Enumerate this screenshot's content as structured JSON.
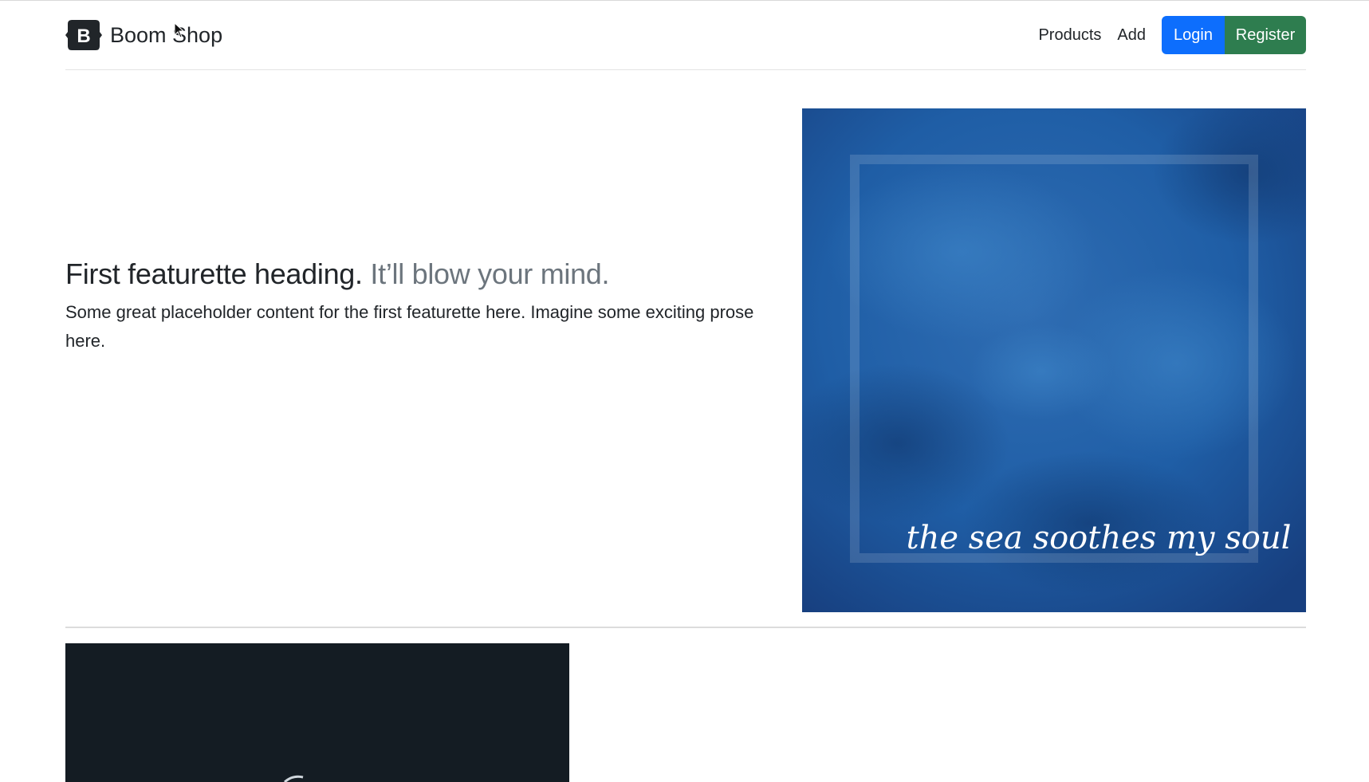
{
  "header": {
    "brand_letter": "B",
    "brand_name": "Boom Shop",
    "nav": {
      "products_label": "Products",
      "add_label": "Add",
      "login_label": "Login",
      "register_label": "Register"
    }
  },
  "feature": {
    "heading": "First featurette heading.",
    "heading_muted": "It’ll blow your mind.",
    "lead": "Some great placeholder content for the first featurette here. Imagine some exciting prose here.",
    "image_caption": "the sea soothes my soul"
  },
  "colors": {
    "primary": "#0d6efd",
    "success": "#2e7d4f",
    "muted": "#6c757d",
    "sea": "#1f5fa8",
    "dark_image": "#141c23"
  }
}
